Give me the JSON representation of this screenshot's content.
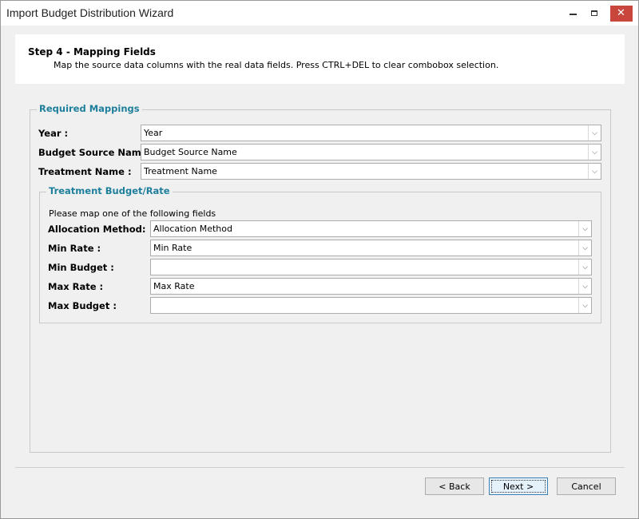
{
  "window": {
    "title": "Import Budget Distribution Wizard"
  },
  "header": {
    "step_title": "Step 4 - Mapping Fields",
    "description": "Map the source data columns with the real data fields. Press CTRL+DEL to clear combobox selection."
  },
  "required": {
    "legend": "Required Mappings",
    "year": {
      "label": "Year :",
      "value": "Year"
    },
    "budget_source": {
      "label": "Budget Source Name :",
      "value": "Budget Source Name"
    },
    "treatment_name": {
      "label": "Treatment Name :",
      "value": "Treatment Name"
    }
  },
  "treatment_budget": {
    "legend": "Treatment Budget/Rate",
    "hint": "Please map one of the following fields",
    "allocation_method": {
      "label": "Allocation Method:",
      "value": "Allocation Method"
    },
    "min_rate": {
      "label": "Min Rate :",
      "value": "Min Rate"
    },
    "min_budget": {
      "label": "Min Budget :",
      "value": ""
    },
    "max_rate": {
      "label": "Max Rate :",
      "value": "Max Rate"
    },
    "max_budget": {
      "label": "Max Budget :",
      "value": ""
    }
  },
  "buttons": {
    "back": "< Back",
    "next": "Next >",
    "cancel": "Cancel"
  },
  "icons": {
    "dropdown": "chevron-down-icon",
    "minimize": "minimize-icon",
    "maximize": "maximize-icon",
    "close": "close-icon"
  },
  "colors": {
    "legend": "#1e7f9c",
    "close_button": "#c8463b",
    "window_bg": "#f0f0f0"
  }
}
